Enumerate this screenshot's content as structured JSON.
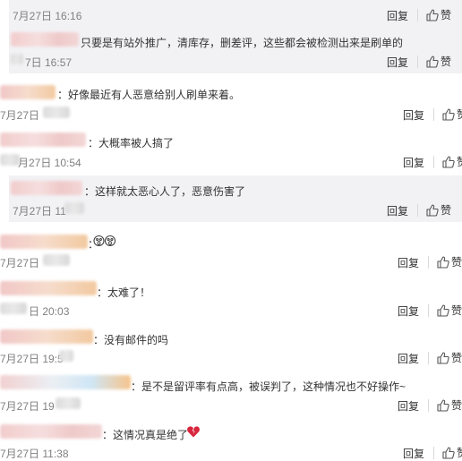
{
  "actions": {
    "reply_label": "回复",
    "like_label": "赞"
  },
  "colors": {
    "shaded_row": "#f2f2f5",
    "text": "#333333",
    "time": "#808080",
    "heart": "#d7263d"
  },
  "comments": [
    {
      "time": "7月27日 16:16"
    },
    {
      "text": "只要是有站外推广，清库存，删差评，这些都会被检测出来是刷单的",
      "time": "7日 16:57"
    },
    {
      "text": "：好像最近有人恶意给别人刷单来着。",
      "time": "7月27日"
    },
    {
      "text": "：大概率被人搞了",
      "time": "月27日 10:54"
    },
    {
      "text": "：这样就太恶心人了，恶意伤害了",
      "time": "7月27日 11"
    },
    {
      "text": "：",
      "emoji": "scream-face-emojis",
      "time": "7月27日"
    },
    {
      "text": "：太难了！",
      "time": "日 20:03"
    },
    {
      "text": "：没有邮件的吗",
      "time": "7月27日 19:5"
    },
    {
      "text": "：是不是留评率有点高，被误判了，这种情况也不好操作~",
      "time": "7月27日 19"
    },
    {
      "text": "：这情况真是绝了",
      "emoji": "broken-heart-icon",
      "time": "7月27日 11:38"
    }
  ]
}
